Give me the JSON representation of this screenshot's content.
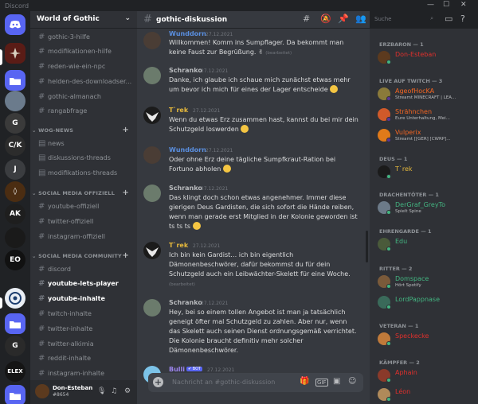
{
  "window": {
    "title": "Discord",
    "controls": {
      "minimize": "—",
      "maximize": "☐",
      "close": "✕"
    }
  },
  "guild": {
    "name": "World of Gothic",
    "chevron_icon": "chevron-down-icon"
  },
  "channels": [
    {
      "name": "gothic-3-hilfe"
    },
    {
      "name": "modifikationen-hilfe"
    },
    {
      "name": "reden-wie-ein-npc"
    },
    {
      "name": "helden-des-downloadser..."
    },
    {
      "name": "gothic-almanach"
    },
    {
      "name": "rangabfrage"
    }
  ],
  "categories": {
    "wog_news": {
      "label": "WOG-NEWS",
      "channels": [
        {
          "name": "news"
        },
        {
          "name": "diskussions-threads"
        },
        {
          "name": "modifikations-threads"
        }
      ]
    },
    "social_offiziell": {
      "label": "SOCIAL MEDIA OFFIZIELL",
      "channels": [
        {
          "name": "youtube-offiziell"
        },
        {
          "name": "twitter-offiziell"
        },
        {
          "name": "instagram-offiziell"
        }
      ]
    },
    "social_community": {
      "label": "SOCIAL MEDIA COMMUNITY",
      "channels": [
        {
          "name": "discord"
        },
        {
          "name": "youtube-lets-player"
        },
        {
          "name": "youtube-inhalte"
        },
        {
          "name": "twitch-inhalte"
        },
        {
          "name": "twitter-inhalte"
        },
        {
          "name": "twitter-alkimia"
        },
        {
          "name": "reddit-inhalte"
        },
        {
          "name": "instagram-inhalte"
        }
      ]
    }
  },
  "user": {
    "name": "Don-Esteban",
    "tag": "#8654"
  },
  "chat": {
    "channel": "gothic-diskussion",
    "messages": [
      {
        "author": "Wunddorn",
        "color": "#5a8fe0",
        "time": "27.12.2021",
        "text": "Willkommen! Komm ins Sumpflager. Da bekommt man keine Faust zur Begrüßung.",
        "edited": "(bearbeitet)"
      },
      {
        "author": "Schranko",
        "color": "#b9bbbe",
        "time": "27.12.2021",
        "text": "Danke, ich glaube ich schaue mich zunächst etwas mehr um bevor ich mich für eines der Lager entscheide"
      },
      {
        "author": "T`rek",
        "color": "#e6b93c",
        "time": "27.12.2021",
        "text": "Wenn du etwas Erz zusammen hast, kannst du bei mir dein Schutzgeld loswerden"
      },
      {
        "author": "Wunddorn",
        "color": "#5a8fe0",
        "time": "27.12.2021",
        "text": "Oder ohne Erz deine tägliche Sumpfkraut-Ration bei Fortuno abholen"
      },
      {
        "author": "Schranko",
        "color": "#b9bbbe",
        "time": "27.12.2021",
        "text": "Das klingt doch schon etwas angenehmer. Immer diese gierigen Deus Gardisten, die sich sofort die Hände reiben, wenn man gerade erst Mitglied in der Kolonie geworden ist ts ts ts"
      },
      {
        "author": "T`rek",
        "color": "#e6b93c",
        "time": "27.12.2021",
        "text": "Ich bin kein Gardist… ich bin eigentlich Dämonenbeschwörer, dafür bekommst du für dein Schutzgeld auch ein Leibwächter-Skelett für eine Woche.",
        "edited": "(bearbeitet)"
      },
      {
        "author": "Schranko",
        "color": "#b9bbbe",
        "time": "27.12.2021",
        "text": "Hey, bei so einem tollen Angebot ist man ja tatsächlich geneigt öfter mal Schutzgeld zu zahlen. Aber nur, wenn das Skelett auch seinen Dienst ordnungsgemäß verrichtet. Die Kolonie braucht definitiv mehr solcher Dämonenbeschwörer."
      },
      {
        "author": "Bulli",
        "color": "#9b84ec",
        "time": "27.12.2021",
        "bot": "✔ BOT"
      }
    ],
    "composer_placeholder": "Nachricht an #gothic-diskussion"
  },
  "search": {
    "placeholder": "Suche"
  },
  "members": {
    "groups": [
      {
        "label": "ERZBARON — 1"
      },
      {
        "label": "LIVE AUF TWITCH — 3"
      },
      {
        "label": "DEUS — 1"
      },
      {
        "label": "DRACHENTÖTER — 1"
      },
      {
        "label": "EHRENGARDE — 1"
      },
      {
        "label": "RITTER — 2"
      },
      {
        "label": "VETERAN — 1"
      },
      {
        "label": "KÄMPFER — 2"
      }
    ],
    "list": [
      {
        "name": "Don-Esteban",
        "color": "#e0302c"
      },
      {
        "name": "AgeofHocKA",
        "color": "#f26522",
        "sub": "Streamt MINECRAFT | LEA..."
      },
      {
        "name": "Strähnchen",
        "color": "#f26522",
        "sub": "Eure Unterhaltung, Mei..."
      },
      {
        "name": "Vulperix",
        "color": "#f26522",
        "sub": "Streamt [[GER] [CWRP]..."
      },
      {
        "name": "T`rek",
        "color": "#e6b93c"
      },
      {
        "name": "DerGraf_GreyTo",
        "color": "#43b581",
        "sub": "Spielt Spine"
      },
      {
        "name": "Edu",
        "color": "#43b581"
      },
      {
        "name": "Domspace",
        "color": "#43b581",
        "sub": "Hört Spotify"
      },
      {
        "name": "LordPappnase",
        "color": "#43b581"
      },
      {
        "name": "Speckecke",
        "color": "#e0302c"
      },
      {
        "name": "Aphain",
        "color": "#e0302c"
      },
      {
        "name": "Léon",
        "color": "#e0302c"
      }
    ]
  }
}
